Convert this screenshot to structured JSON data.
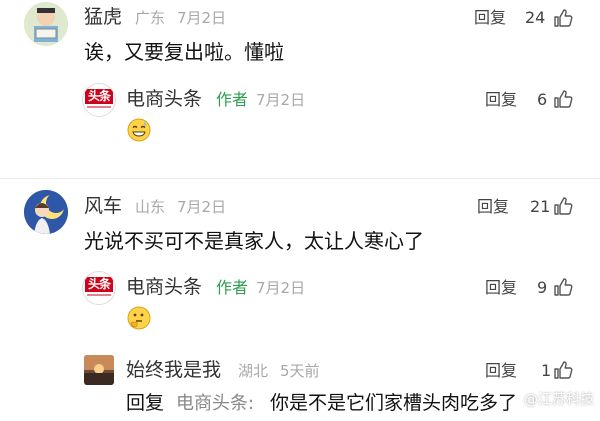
{
  "comments": [
    {
      "user": "猛虎",
      "location": "广东",
      "date": "7月2日",
      "reply_label": "回复",
      "likes": "24",
      "text": "诶，又要复出啦。懂啦",
      "avatar_icon": "cartoon-boy-reading-avatar",
      "replies": [
        {
          "user": "电商头条",
          "badge": "作者",
          "date": "7月2日",
          "reply_label": "回复",
          "likes": "6",
          "logo_text": "头条",
          "emoji": "sweat-smile-emoji"
        }
      ]
    },
    {
      "user": "风车",
      "location": "山东",
      "date": "7月2日",
      "reply_label": "回复",
      "likes": "21",
      "text": "光说不买可不是真家人，太让人寒心了",
      "avatar_icon": "girl-moon-avatar",
      "replies": [
        {
          "user": "电商头条",
          "badge": "作者",
          "date": "7月2日",
          "reply_label": "回复",
          "likes": "9",
          "logo_text": "头条",
          "emoji": "thinking-emoji"
        },
        {
          "user": "始终我是我",
          "location": "湖北",
          "date": "5天前",
          "reply_label": "回复",
          "likes": "1",
          "reply_prefix": "回复",
          "reply_target": "电商头条:",
          "text": "你是不是它们家槽头肉吃多了",
          "avatar_icon": "sunset-avatar"
        }
      ]
    }
  ],
  "watermark": "@江苏科技",
  "colors": {
    "author_green": "#2e9e4f",
    "meta_gray": "#a8a8a8",
    "brand_red": "#d0021b"
  }
}
